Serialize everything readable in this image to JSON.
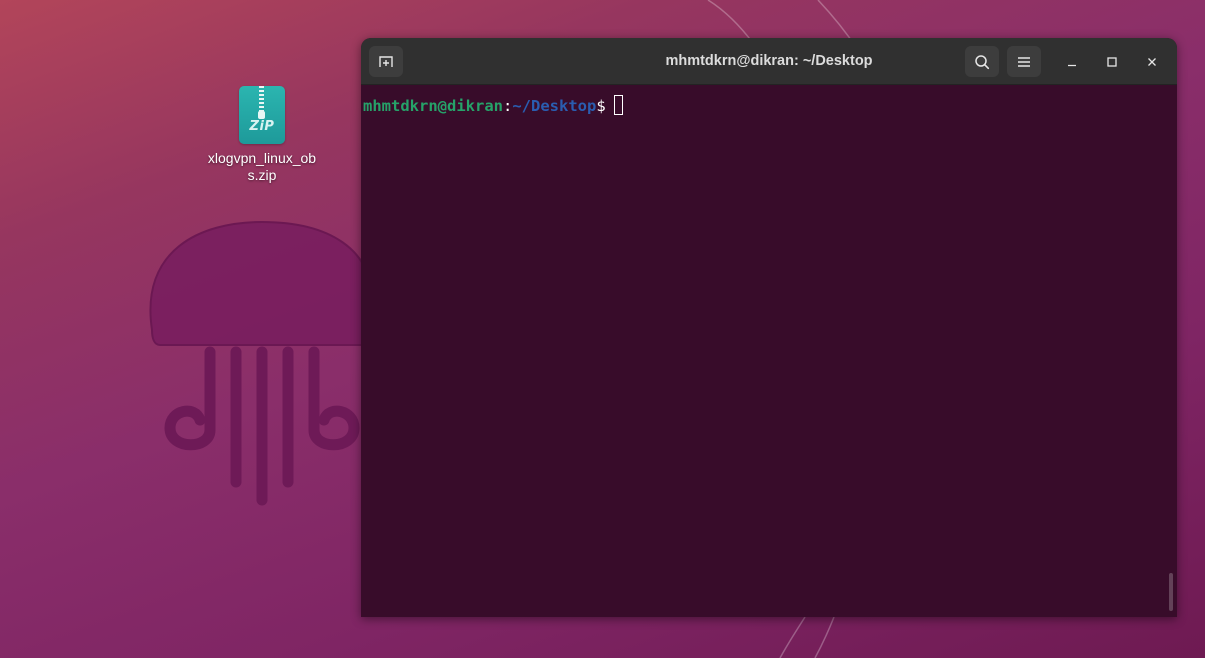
{
  "desktop": {
    "icons": [
      {
        "label": "xlogvpn_linux_obs.zip",
        "icon": "zip-archive-icon",
        "badge_text": "ZiP"
      }
    ]
  },
  "terminal": {
    "title": "mhmtdkrn@dikran: ~/Desktop",
    "prompt": {
      "user_host": "mhmtdkrn@dikran",
      "separator": ":",
      "path": "~/Desktop",
      "symbol": "$"
    },
    "headerbar_icons": {
      "new_tab": "new-tab-icon",
      "search": "search-icon",
      "menu": "hamburger-menu-icon",
      "minimize": "minimize-icon",
      "maximize": "maximize-icon",
      "close": "close-icon"
    }
  },
  "colors": {
    "terminal_bg": "#380c2a",
    "headerbar_bg": "#303030",
    "prompt_user": "#26a269",
    "prompt_path": "#2a5db0",
    "zip_icon": "#2bb5b0"
  }
}
